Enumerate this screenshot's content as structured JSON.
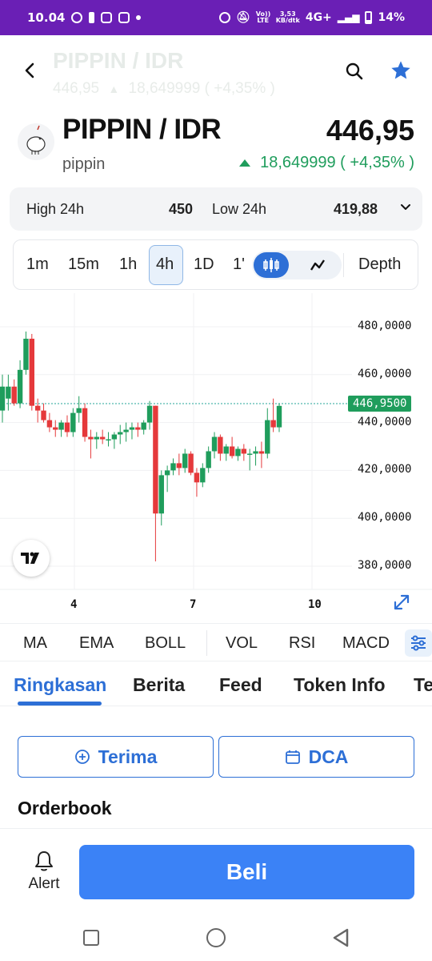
{
  "status_bar": {
    "time": "10.04",
    "net_speed_value": "3,53",
    "net_speed_unit": "KB/dtk",
    "volte": "Vo)) LTE",
    "network": "4G+",
    "battery": "14%"
  },
  "header": {
    "ghost_title": "PIPPIN / IDR",
    "ghost_price": "446,95",
    "ghost_change": "18,649999 ( +4,35% )"
  },
  "pair": {
    "title": "PIPPIN / IDR",
    "subtitle": "pippin",
    "price": "446,95",
    "change": "18,649999 ( +4,35% )",
    "change_color": "#1f9d5c"
  },
  "stats": {
    "high_label": "High 24h",
    "high_value": "450",
    "low_label": "Low 24h",
    "low_value": "419,88"
  },
  "timeframes": {
    "items": [
      "1m",
      "15m",
      "1h",
      "4h",
      "1D",
      "1'"
    ],
    "active": "4h",
    "depth_label": "Depth"
  },
  "chart_data": {
    "type": "candlestick",
    "current_price_label": "446,9500",
    "y_ticks": [
      "480,0000",
      "460,0000",
      "440,0000",
      "420,0000",
      "400,0000",
      "380,0000"
    ],
    "x_ticks": [
      "4",
      "7",
      "10"
    ],
    "ylim": [
      375,
      490
    ],
    "colors": {
      "up": "#26a69a",
      "down": "#ef5350",
      "up_solid": "#1f9d5c",
      "down_solid": "#e5393b"
    },
    "candles": [
      {
        "o": 445,
        "h": 460,
        "l": 440,
        "c": 455
      },
      {
        "o": 450,
        "h": 460,
        "l": 445,
        "c": 455
      },
      {
        "o": 455,
        "h": 458,
        "l": 447,
        "c": 448
      },
      {
        "o": 448,
        "h": 466,
        "l": 446,
        "c": 462
      },
      {
        "o": 462,
        "h": 478,
        "l": 460,
        "c": 475
      },
      {
        "o": 475,
        "h": 477,
        "l": 445,
        "c": 447
      },
      {
        "o": 447,
        "h": 450,
        "l": 440,
        "c": 445
      },
      {
        "o": 445,
        "h": 448,
        "l": 440,
        "c": 441
      },
      {
        "o": 441,
        "h": 444,
        "l": 436,
        "c": 438
      },
      {
        "o": 438,
        "h": 441,
        "l": 434,
        "c": 437
      },
      {
        "o": 437,
        "h": 441,
        "l": 434,
        "c": 440
      },
      {
        "o": 440,
        "h": 443,
        "l": 434,
        "c": 436
      },
      {
        "o": 436,
        "h": 446,
        "l": 434,
        "c": 444
      },
      {
        "o": 444,
        "h": 451,
        "l": 440,
        "c": 446
      },
      {
        "o": 446,
        "h": 448,
        "l": 432,
        "c": 434
      },
      {
        "o": 434,
        "h": 437,
        "l": 425,
        "c": 433
      },
      {
        "o": 433,
        "h": 436,
        "l": 429,
        "c": 434
      },
      {
        "o": 434,
        "h": 437,
        "l": 431,
        "c": 433
      },
      {
        "o": 433,
        "h": 436,
        "l": 430,
        "c": 433
      },
      {
        "o": 433,
        "h": 436,
        "l": 429,
        "c": 435
      },
      {
        "o": 435,
        "h": 439,
        "l": 431,
        "c": 436
      },
      {
        "o": 436,
        "h": 440,
        "l": 432,
        "c": 437
      },
      {
        "o": 437,
        "h": 440,
        "l": 433,
        "c": 438
      },
      {
        "o": 438,
        "h": 440,
        "l": 434,
        "c": 437
      },
      {
        "o": 437,
        "h": 441,
        "l": 435,
        "c": 440
      },
      {
        "o": 440,
        "h": 449,
        "l": 437,
        "c": 447
      },
      {
        "o": 447,
        "h": 447,
        "l": 382,
        "c": 402
      },
      {
        "o": 402,
        "h": 420,
        "l": 397,
        "c": 418
      },
      {
        "o": 418,
        "h": 422,
        "l": 411,
        "c": 420
      },
      {
        "o": 420,
        "h": 425,
        "l": 418,
        "c": 423
      },
      {
        "o": 423,
        "h": 427,
        "l": 418,
        "c": 421
      },
      {
        "o": 421,
        "h": 429,
        "l": 419,
        "c": 427
      },
      {
        "o": 427,
        "h": 428,
        "l": 418,
        "c": 419
      },
      {
        "o": 419,
        "h": 421,
        "l": 409,
        "c": 415
      },
      {
        "o": 415,
        "h": 423,
        "l": 413,
        "c": 421
      },
      {
        "o": 421,
        "h": 430,
        "l": 419,
        "c": 428
      },
      {
        "o": 428,
        "h": 436,
        "l": 425,
        "c": 434
      },
      {
        "o": 434,
        "h": 435,
        "l": 424,
        "c": 427
      },
      {
        "o": 427,
        "h": 431,
        "l": 424,
        "c": 430
      },
      {
        "o": 430,
        "h": 434,
        "l": 425,
        "c": 426
      },
      {
        "o": 426,
        "h": 430,
        "l": 424,
        "c": 429
      },
      {
        "o": 429,
        "h": 431,
        "l": 424,
        "c": 427
      },
      {
        "o": 427,
        "h": 429,
        "l": 420,
        "c": 427
      },
      {
        "o": 427,
        "h": 430,
        "l": 422,
        "c": 428
      },
      {
        "o": 428,
        "h": 432,
        "l": 421,
        "c": 427
      },
      {
        "o": 427,
        "h": 446,
        "l": 425,
        "c": 441
      },
      {
        "o": 441,
        "h": 450,
        "l": 436,
        "c": 438
      },
      {
        "o": 438,
        "h": 448,
        "l": 436,
        "c": 446.95
      }
    ]
  },
  "indicators": [
    "MA",
    "EMA",
    "BOLL",
    "VOL",
    "RSI",
    "MACD"
  ],
  "tabs": [
    "Ringkasan",
    "Berita",
    "Feed",
    "Token Info",
    "Te"
  ],
  "actions": {
    "receive_label": "Terima",
    "dca_label": "DCA",
    "section_title": "Orderbook"
  },
  "bottom": {
    "alert_label": "Alert",
    "buy_label": "Beli"
  },
  "colors": {
    "accent": "#2d6fd6",
    "buy": "#3b82f6",
    "status_bar": "#6a1fb5",
    "positive": "#1f9d5c",
    "negative": "#e5393b"
  }
}
